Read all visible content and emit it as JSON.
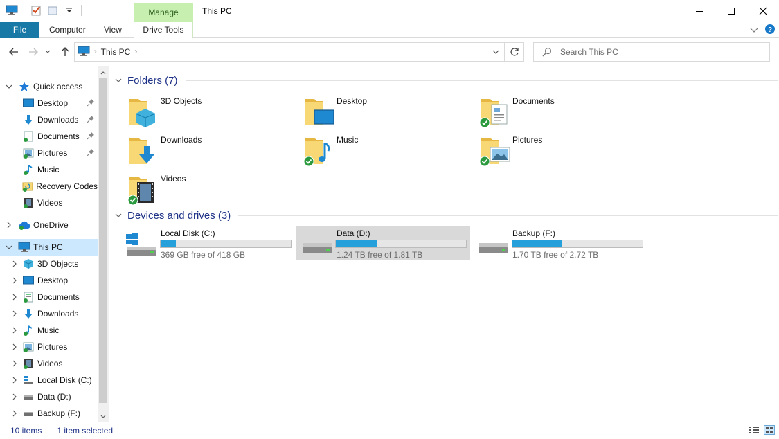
{
  "window": {
    "title": "This PC",
    "context_tab": "Manage",
    "controls": [
      "minimize",
      "maximize",
      "close"
    ]
  },
  "ribbon": {
    "tabs": [
      {
        "label": "File"
      },
      {
        "label": "Computer"
      },
      {
        "label": "View"
      },
      {
        "label": "Drive Tools"
      }
    ]
  },
  "address": {
    "path": "This PC",
    "search_placeholder": "Search This PC"
  },
  "nav": {
    "quick_access": {
      "label": "Quick access",
      "items": [
        {
          "label": "Desktop",
          "icon": "desktop-icon",
          "pinned": true
        },
        {
          "label": "Downloads",
          "icon": "download-icon",
          "pinned": true
        },
        {
          "label": "Documents",
          "icon": "documents-icon",
          "pinned": true
        },
        {
          "label": "Pictures",
          "icon": "pictures-icon",
          "pinned": true
        },
        {
          "label": "Music",
          "icon": "music-icon",
          "pinned": false
        },
        {
          "label": "Recovery Codes",
          "icon": "recovery-folder-icon",
          "pinned": false
        },
        {
          "label": "Videos",
          "icon": "videos-icon",
          "pinned": false
        }
      ]
    },
    "onedrive": {
      "label": "OneDrive"
    },
    "this_pc": {
      "label": "This PC",
      "items": [
        {
          "label": "3D Objects",
          "icon": "3d-objects-icon"
        },
        {
          "label": "Desktop",
          "icon": "desktop-icon"
        },
        {
          "label": "Documents",
          "icon": "documents-icon"
        },
        {
          "label": "Downloads",
          "icon": "download-icon"
        },
        {
          "label": "Music",
          "icon": "music-icon"
        },
        {
          "label": "Pictures",
          "icon": "pictures-icon"
        },
        {
          "label": "Videos",
          "icon": "videos-icon"
        },
        {
          "label": "Local Disk (C:)",
          "icon": "windows-drive-icon"
        },
        {
          "label": "Data (D:)",
          "icon": "drive-icon"
        },
        {
          "label": "Backup (F:)",
          "icon": "drive-icon"
        }
      ]
    }
  },
  "content": {
    "folders_header": "Folders (7)",
    "folders": [
      {
        "label": "3D Objects",
        "overlay": "3d",
        "synced": false
      },
      {
        "label": "Desktop",
        "overlay": "desktop",
        "synced": false
      },
      {
        "label": "Documents",
        "overlay": "document",
        "synced": true
      },
      {
        "label": "Downloads",
        "overlay": "download",
        "synced": false
      },
      {
        "label": "Music",
        "overlay": "music",
        "synced": true
      },
      {
        "label": "Pictures",
        "overlay": "picture",
        "synced": true
      },
      {
        "label": "Videos",
        "overlay": "video",
        "synced": true
      }
    ],
    "drives_header": "Devices and drives (3)",
    "drives": [
      {
        "name": "Local Disk (C:)",
        "free_text": "369 GB free of 418 GB",
        "used_fraction": 0.117,
        "selected": false,
        "system": true
      },
      {
        "name": "Data (D:)",
        "free_text": "1.24 TB free of 1.81 TB",
        "used_fraction": 0.315,
        "selected": true,
        "system": false
      },
      {
        "name": "Backup (F:)",
        "free_text": "1.70 TB free of 2.72 TB",
        "used_fraction": 0.375,
        "selected": false,
        "system": false
      }
    ]
  },
  "status": {
    "items_count": "10 items",
    "selection": "1 item selected"
  },
  "colors": {
    "file_tab": "#1979a6",
    "manage_tab": "#c6efb0",
    "selected_nav": "#cce8ff",
    "header_text": "#1e3287",
    "drive_bar": "#26a0da",
    "folder_yellow": "#f8d775"
  }
}
